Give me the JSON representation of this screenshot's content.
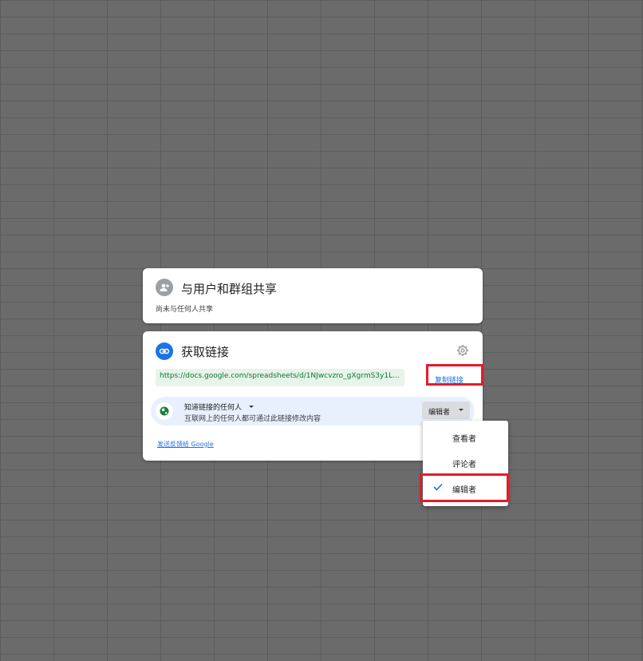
{
  "share_card": {
    "title": "与用户和群组共享",
    "subtitle": "尚未与任何人共享",
    "icon": "add-person-icon"
  },
  "link_card": {
    "title": "获取链接",
    "icon": "link-icon",
    "settings_icon": "gear-icon",
    "url": "https://docs.google.com/spreadsheets/d/1NJwcvzro_gXgrmS3y1LBDPaNvc...",
    "copy_link_label": "复制链接",
    "access": {
      "title": "知道链接的任何人",
      "description": "互联网上的任何人都可通过此链接修改内容",
      "role": "编辑者",
      "icon": "globe-icon"
    },
    "feedback_label": "发送反馈给 Google"
  },
  "role_menu": {
    "items": [
      {
        "label": "查看者",
        "selected": false
      },
      {
        "label": "评论者",
        "selected": false
      },
      {
        "label": "编辑者",
        "selected": true
      }
    ]
  },
  "colors": {
    "accent": "#1a73e8",
    "highlight": "#e8192c",
    "url_bg": "#e6f4ea",
    "access_bg": "#e8f0fe"
  }
}
